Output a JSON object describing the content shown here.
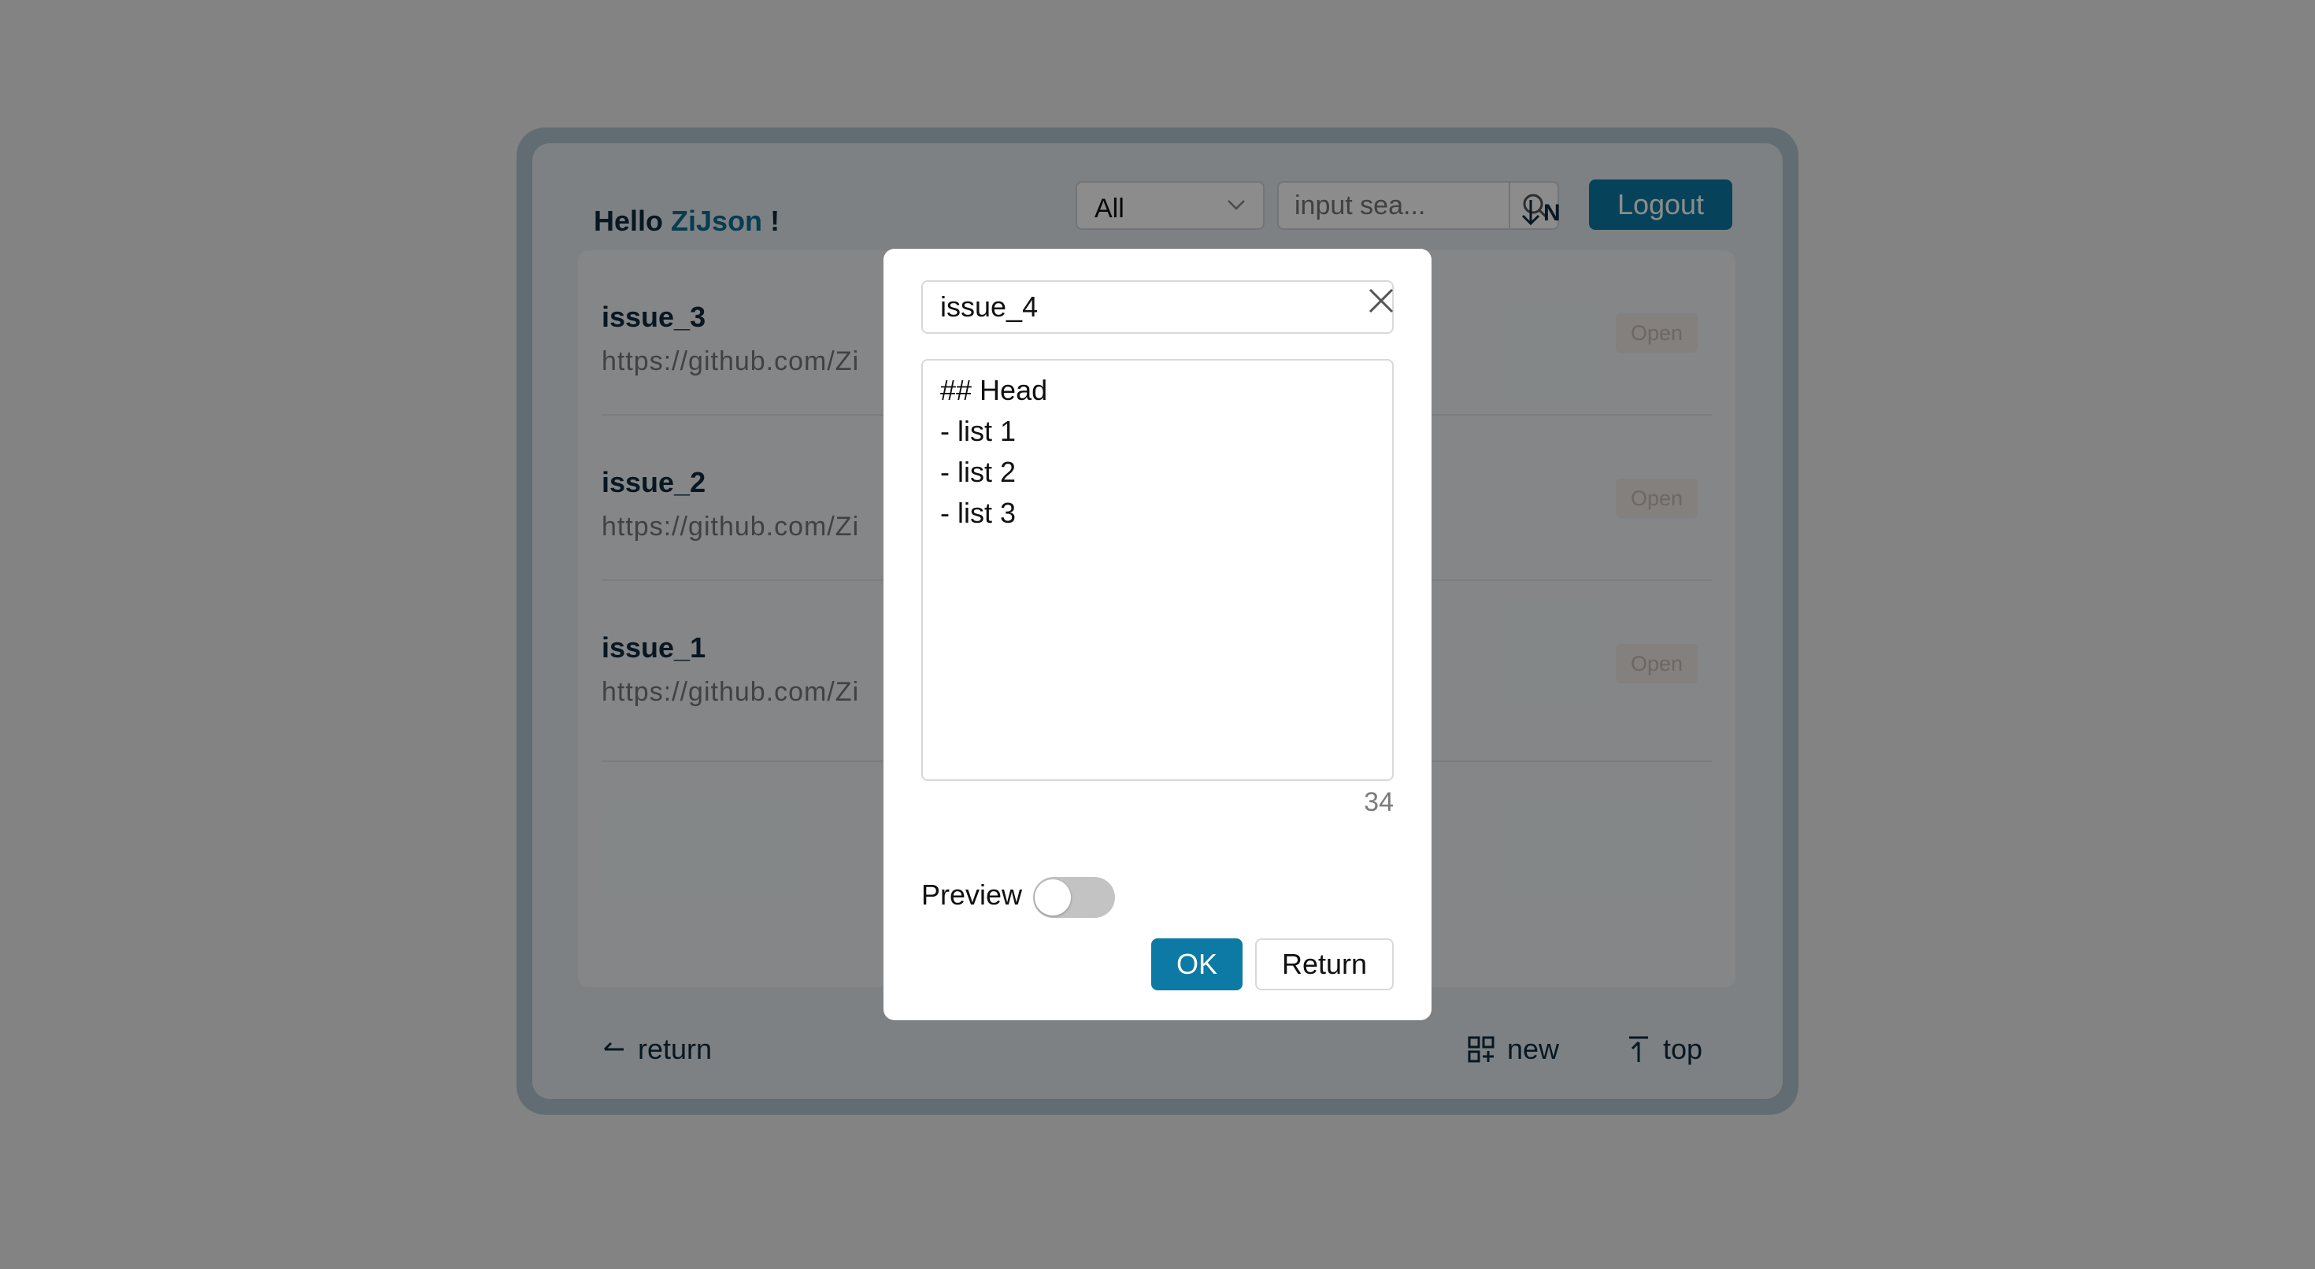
{
  "header": {
    "greeting_prefix": "Hello",
    "username": "ZiJson",
    "greeting_suffix": "!",
    "filter_value": "All",
    "search_placeholder": "input sea...",
    "sort_label": "N",
    "logout_label": "Logout"
  },
  "issues": [
    {
      "title": "issue_3",
      "url": "https://github.com/Zi",
      "status": "Open"
    },
    {
      "title": "issue_2",
      "url": "https://github.com/Zi",
      "status": "Open"
    },
    {
      "title": "issue_1",
      "url": "https://github.com/Zi",
      "status": "Open"
    }
  ],
  "footer": {
    "return_label": "return",
    "new_label": "new",
    "top_label": "top"
  },
  "modal": {
    "title_value": "issue_4",
    "body_value": "## Head\n- list 1\n- list 2\n- list 3",
    "char_count": "34",
    "preview_label": "Preview",
    "preview_enabled": false,
    "ok_label": "OK",
    "return_label": "Return"
  },
  "colors": {
    "accent": "#0c7aa4",
    "badge_bg": "#efe9e4",
    "badge_text": "#c7bcb2",
    "toggle_off": "#c3c3c3"
  }
}
